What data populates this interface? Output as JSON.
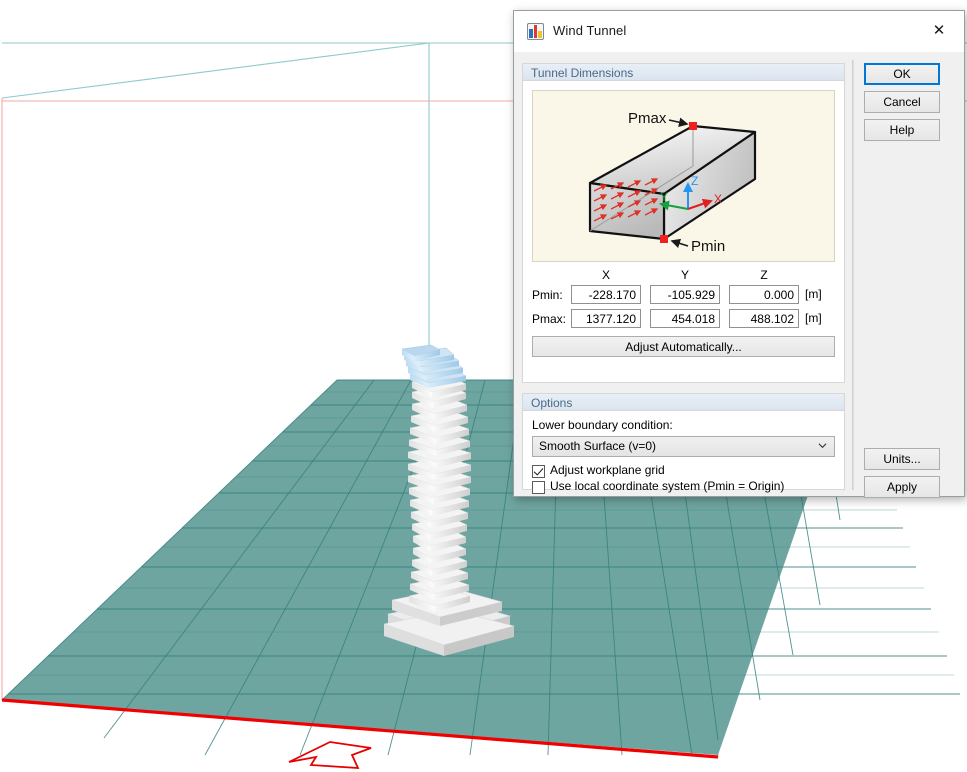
{
  "viewport": {
    "name": "3d-model-viewport",
    "description": "3D model view of a twisting stacked-slab tower on a teal grid ground plane inside a wind-tunnel wireframe box",
    "colors": {
      "background": "#ffffff",
      "ground_fill": "#6da39e",
      "ground_grid": "#2f7a77",
      "ground_front_edge": "#f20000",
      "wire_teal": "#8fc9c9",
      "wire_pink": "#f2a8a8",
      "building_light": "#f4f4f4",
      "building_shade": "#d2d2d2",
      "building_top_highlight": "#aed4ef",
      "direction_arrow": "#e60000"
    },
    "direction_arrow_label": "wind-direction-arrow"
  },
  "dialog": {
    "title": "Wind Tunnel",
    "icon": "wind-tunnel-app-icon",
    "close_label": "✕",
    "tunnel_group": {
      "title": "Tunnel Dimensions",
      "preview": {
        "label_pmax": "Pmax",
        "label_pmin": "Pmin",
        "axis_x": "X",
        "axis_y": "Y",
        "axis_z": "Z",
        "background": "#fbf7e8",
        "arrow_color": "#e03127"
      },
      "columns": [
        "X",
        "Y",
        "Z"
      ],
      "rows": [
        {
          "label": "Pmin:",
          "x": "-228.170",
          "y": "-105.929",
          "z": "0.000",
          "unit": "[m]"
        },
        {
          "label": "Pmax:",
          "x": "1377.120",
          "y": "454.018",
          "z": "488.102",
          "unit": "[m]"
        }
      ],
      "adjust_button": "Adjust Automatically..."
    },
    "options_group": {
      "title": "Options",
      "lower_boundary_label": "Lower boundary condition:",
      "lower_boundary_value": "Smooth Surface (v=0)",
      "checkboxes": [
        {
          "label": "Adjust workplane grid",
          "checked": true
        },
        {
          "label": "Use local coordinate system (Pmin = Origin)",
          "checked": false
        }
      ]
    },
    "buttons": {
      "ok": "OK",
      "cancel": "Cancel",
      "help": "Help",
      "units": "Units...",
      "apply": "Apply"
    }
  }
}
